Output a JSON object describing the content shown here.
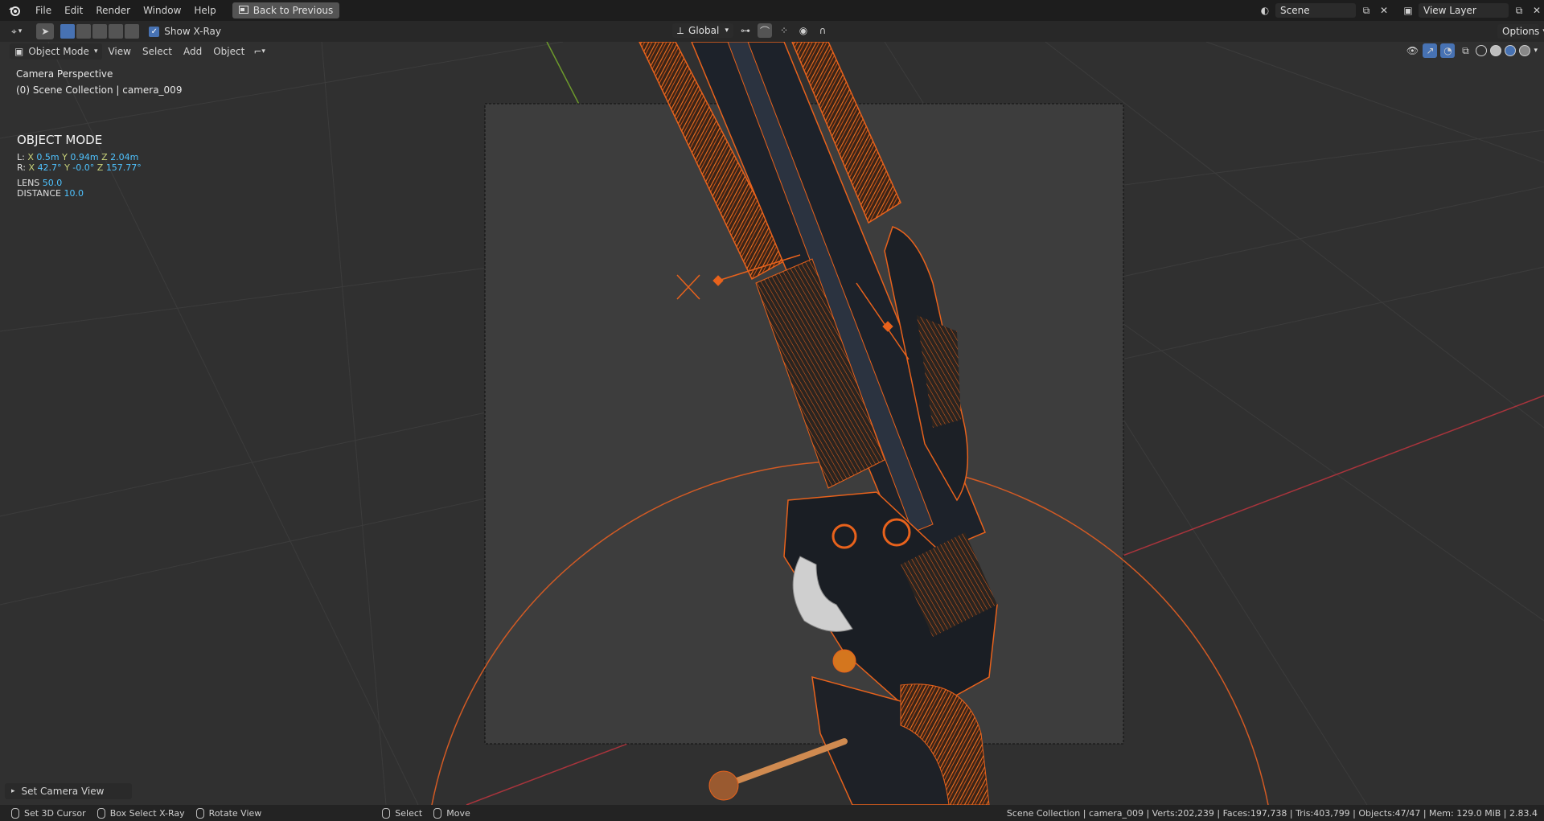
{
  "menubar": {
    "items": [
      "File",
      "Edit",
      "Render",
      "Window",
      "Help"
    ],
    "back_button": "Back to Previous",
    "scene_name": "Scene",
    "view_layer_name": "View Layer"
  },
  "toolbar": {
    "xray_label": "Show X-Ray",
    "xray_checked": true,
    "transform_orientation": "Global",
    "options_label": "Options"
  },
  "viewport_header": {
    "mode_label": "Object Mode",
    "menus": [
      "View",
      "Select",
      "Add",
      "Object"
    ]
  },
  "viewport_overlay": {
    "perspective": "Camera Perspective",
    "collection": "(0) Scene Collection | camera_009",
    "mode_title": "OBJECT MODE",
    "location": {
      "prefix": "L:",
      "x": "0.5m",
      "y": "0.94m",
      "z": "2.04m"
    },
    "rotation": {
      "prefix": "R:",
      "x": "42.7°",
      "y": "-0.0°",
      "z": "157.77°"
    },
    "lens_label": "LENS",
    "lens_value": "50.0",
    "distance_label": "DISTANCE",
    "distance_value": "10.0"
  },
  "last_operator": "Set Camera View",
  "statusbar": {
    "items": [
      "Set 3D Cursor",
      "Box Select X-Ray",
      "Rotate View",
      "Select",
      "Move"
    ],
    "info": "Scene Collection | camera_009 | Verts:202,239 | Faces:197,738 | Tris:403,799 | Objects:47/47 | Mem: 129.0 MiB | 2.83.4"
  },
  "colors": {
    "accent": "#4772b3",
    "selection_orange": "#e8621c",
    "value_blue": "#4fc3ff"
  }
}
